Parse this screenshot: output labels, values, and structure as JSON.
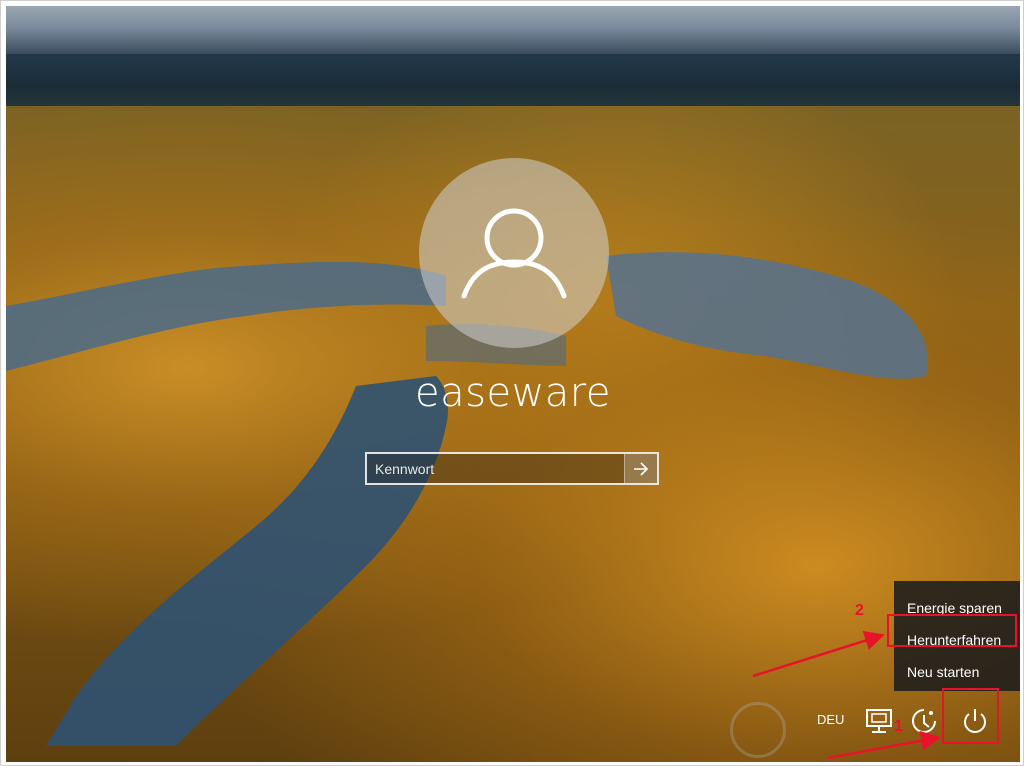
{
  "login": {
    "username": "easeware",
    "password_placeholder": "Kennwort"
  },
  "power_menu": {
    "items": [
      {
        "label": "Energie sparen"
      },
      {
        "label": "Herunterfahren"
      },
      {
        "label": "Neu starten"
      }
    ]
  },
  "tray": {
    "language": "DEU",
    "icons": [
      "network-icon",
      "ease-of-access-icon",
      "power-icon"
    ]
  },
  "annotations": {
    "step1": "1",
    "step2": "2",
    "color": "#e8132b"
  }
}
